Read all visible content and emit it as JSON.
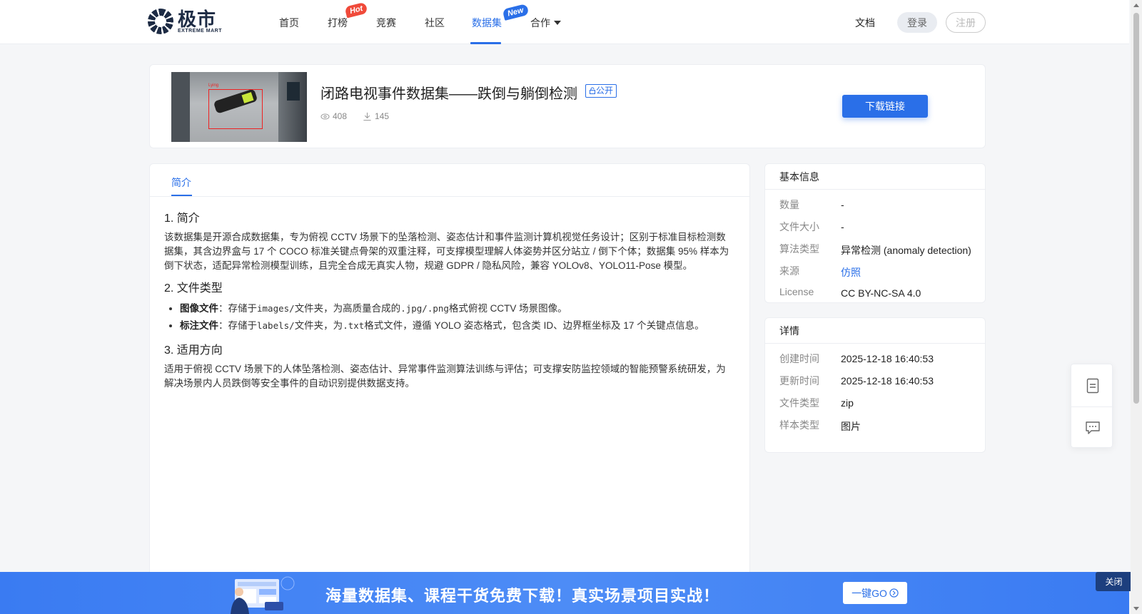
{
  "nav": {
    "logo_cn": "极市",
    "logo_en": "EXTREME MART",
    "items": [
      {
        "label": "首页"
      },
      {
        "label": "打榜",
        "badge": "Hot"
      },
      {
        "label": "竞赛"
      },
      {
        "label": "社区"
      },
      {
        "label": "数据集",
        "badge": "New",
        "active": true
      },
      {
        "label": "合作"
      }
    ],
    "docs": "文档",
    "login": "登录",
    "register": "注册"
  },
  "dataset": {
    "title": "闭路电视事件数据集——跌倒与躺倒检测",
    "tag": "公开",
    "views": "408",
    "downloads": "145",
    "download_button": "下载链接"
  },
  "tabs": [
    {
      "label": "简介",
      "active": true
    }
  ],
  "intro": {
    "h1": "1. 简介",
    "p1": "该数据集是开源合成数据集，专为俯视 CCTV 场景下的坠落检测、姿态估计和事件监测计算机视觉任务设计；区别于标准目标检测数据集，其含边界盒与 17 个 COCO 标准关键点骨架的双重注释，可支撑模型理解人体姿势并区分站立 / 倒下个体；数据集 95% 样本为倒下状态，适配异常检测模型训练，且完全合成无真实人物，规避 GDPR / 隐私风险，兼容 YOLOv8、YOLO11-Pose 模型。",
    "h2": "2. 文件类型",
    "li1_bold": "图像文件",
    "li1_a": "：存储于",
    "li1_code1": "images/",
    "li1_b": "文件夹，为高质量合成的",
    "li1_code2": ".jpg/.png",
    "li1_c": "格式俯视 CCTV 场景图像。",
    "li2_bold": "标注文件",
    "li2_a": "：存储于",
    "li2_code1": "labels/",
    "li2_b": "文件夹，为",
    "li2_code2": ".txt",
    "li2_c": "格式文件，遵循 YOLO 姿态格式，包含类 ID、边界框坐标及 17 个关键点信息。",
    "h3": "3. 适用方向",
    "p3": "适用于俯视 CCTV 场景下的人体坠落检测、姿态估计、异常事件监测算法训练与评估；可支撑安防监控领域的智能预警系统研发，为解决场景内人员跌倒等安全事件的自动识别提供数据支持。"
  },
  "thumb_label": "Lying",
  "basic_info": {
    "title": "基本信息",
    "rows": [
      {
        "k": "数量",
        "v": "-"
      },
      {
        "k": "文件大小",
        "v": "-"
      },
      {
        "k": "算法类型",
        "v": "异常检测 (anomaly detection)"
      },
      {
        "k": "来源",
        "v": "仿照"
      },
      {
        "k": "License",
        "v": "CC BY-NC-SA 4.0"
      }
    ]
  },
  "details": {
    "title": "详情",
    "rows": [
      {
        "k": "创建时间",
        "v": "2025-12-18 16:40:53"
      },
      {
        "k": "更新时间",
        "v": "2025-12-18 16:40:53"
      },
      {
        "k": "文件类型",
        "v": "zip"
      },
      {
        "k": "样本类型",
        "v": "图片"
      }
    ]
  },
  "banner": {
    "text": "海量数据集、课程干货免费下载！真实场景项目实战！",
    "button": "一键GO",
    "close": "关闭"
  },
  "colors": {
    "accent": "#2a6fe8",
    "hot": "#f04a3a",
    "banner": "#3a7bf2"
  }
}
